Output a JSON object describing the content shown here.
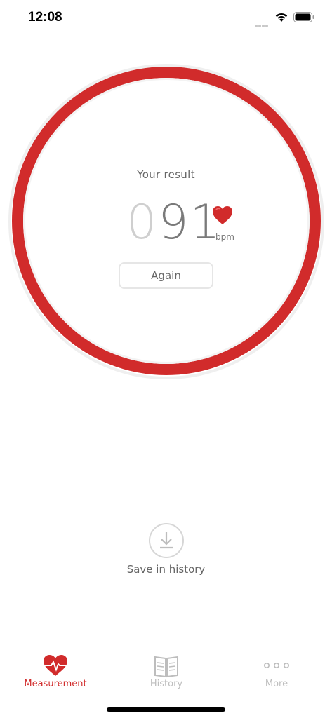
{
  "status_bar": {
    "time": "12:08"
  },
  "measurement": {
    "result_label": "Your result",
    "bpm_leading": "0",
    "bpm_value": "91",
    "bpm_unit": "bpm",
    "again_label": "Again"
  },
  "save": {
    "label": "Save in history"
  },
  "tabs": [
    {
      "label": "Measurement",
      "icon": "heart-pulse-icon",
      "active": true
    },
    {
      "label": "History",
      "icon": "book-icon",
      "active": false
    },
    {
      "label": "More",
      "icon": "more-dots-icon",
      "active": false
    }
  ],
  "colors": {
    "accent": "#d12b2b",
    "ring_outer": "#efefef",
    "inactive": "#bdbdbd"
  }
}
